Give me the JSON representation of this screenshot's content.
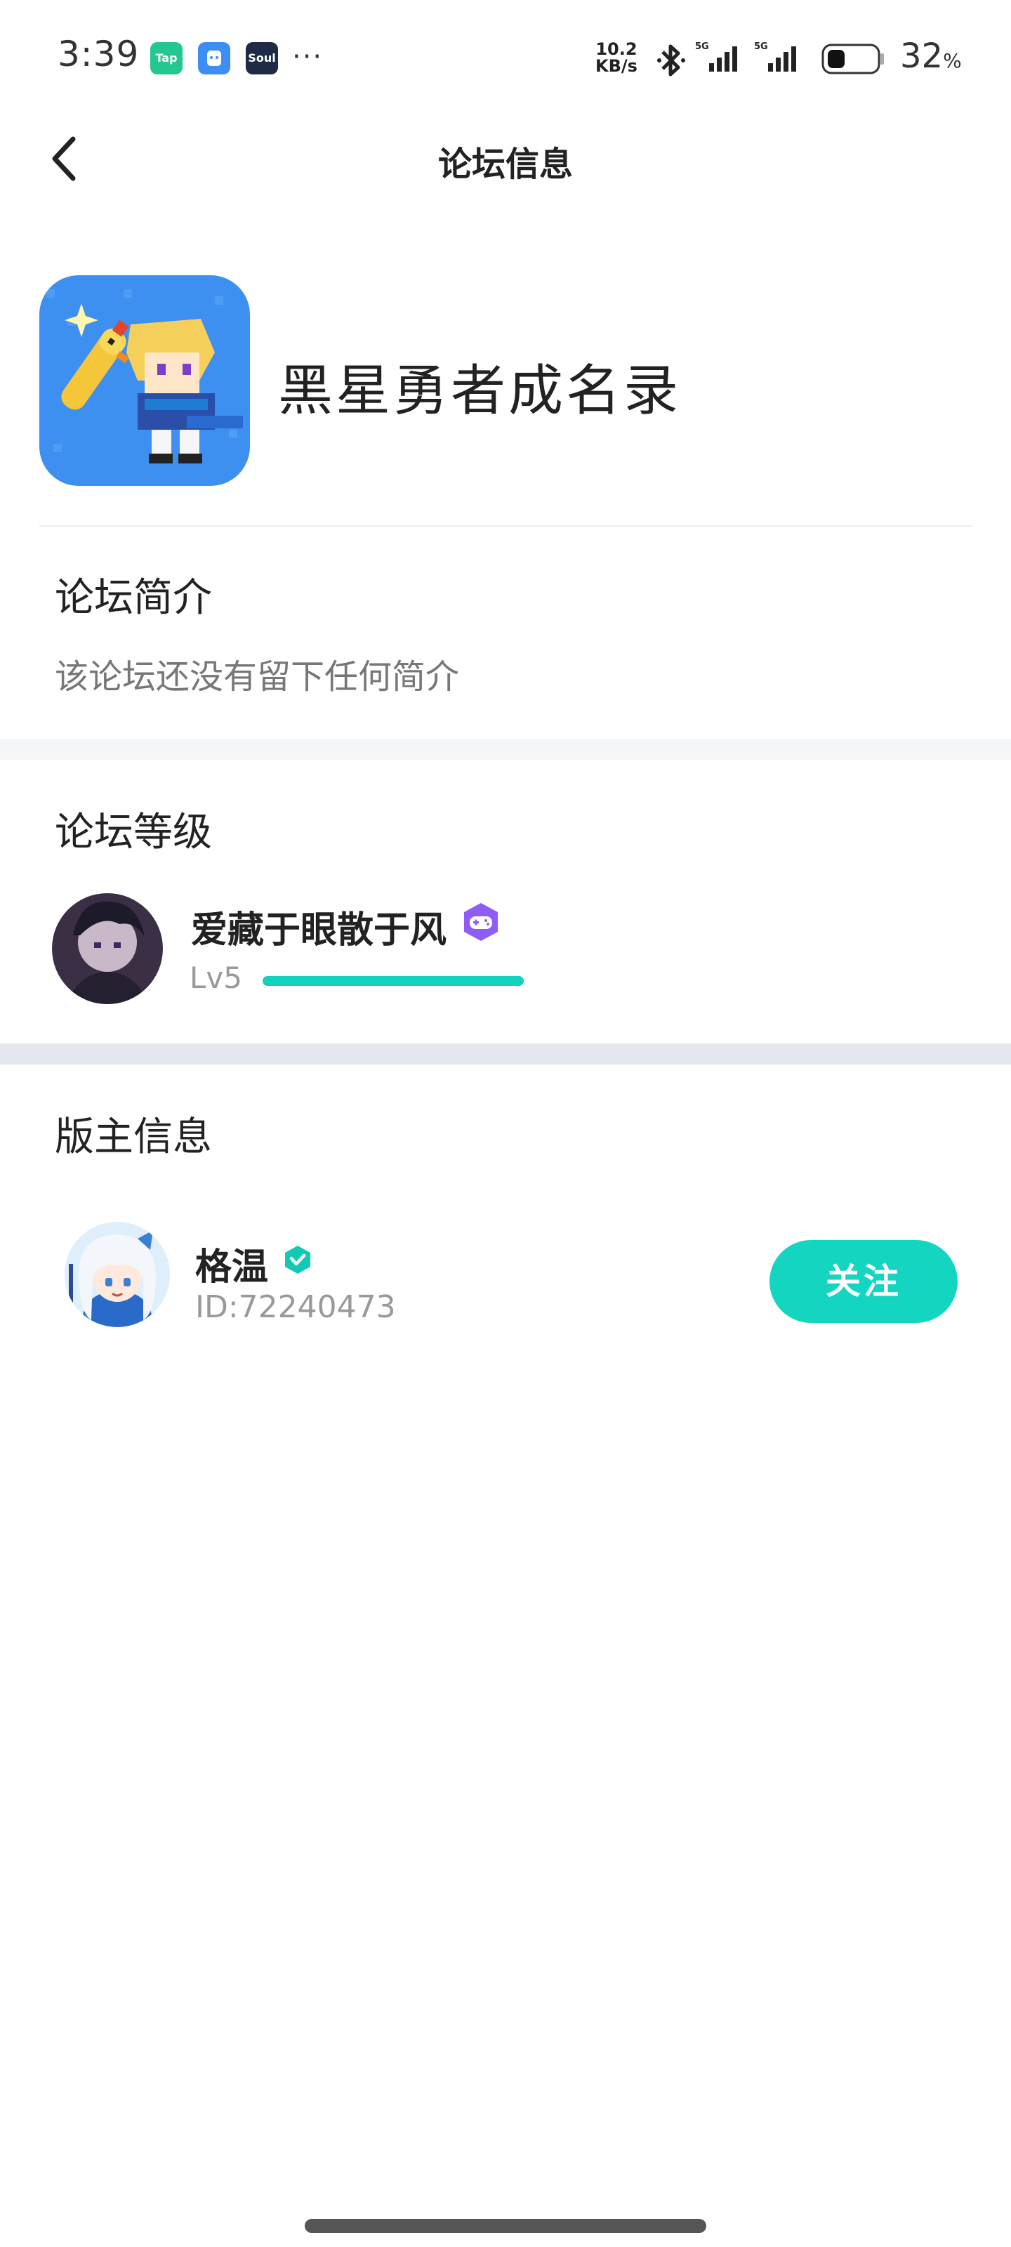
{
  "status_bar": {
    "time": "3:39",
    "apps": [
      {
        "name": "Tap",
        "color": "#23c78f"
      },
      {
        "name": "",
        "color": "#3c8ef4"
      },
      {
        "name": "Soul",
        "color": "#1f2a44"
      }
    ],
    "more": "···",
    "net_speed_value": "10.2",
    "net_speed_unit": "KB/s",
    "signal_label_1": "5G",
    "signal_label_2": "5G",
    "battery_value": "32",
    "battery_unit": "%"
  },
  "header": {
    "title": "论坛信息"
  },
  "game": {
    "name": "黑星勇者成名录"
  },
  "intro": {
    "title": "论坛简介",
    "text": "该论坛还没有留下任何简介"
  },
  "level": {
    "title": "论坛等级",
    "user_name": "爱藏于眼散于风",
    "level_label": "Lv5",
    "progress": 1.0,
    "accent": "#14d1bd",
    "badge_color": "#8f5cf6"
  },
  "moderator": {
    "title": "版主信息",
    "name": "格温",
    "id_text": "ID:72240473",
    "follow_label": "关注",
    "accent": "#14d6c0"
  }
}
